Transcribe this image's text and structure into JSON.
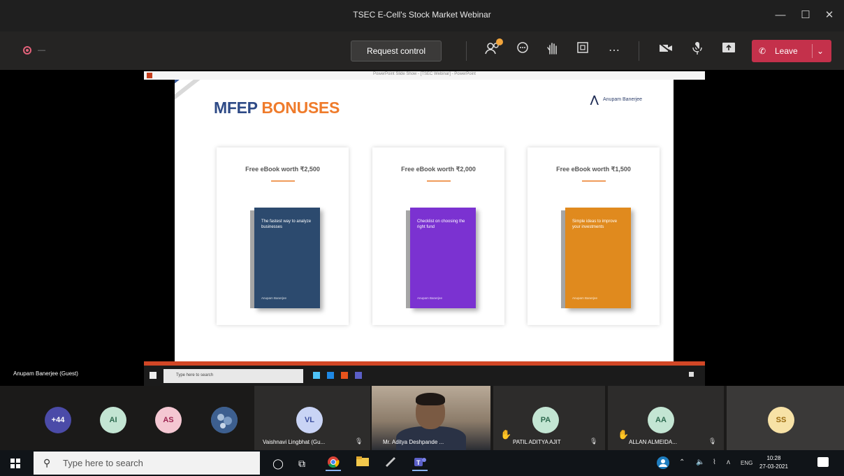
{
  "window": {
    "title": "TSEC E-Cell's Stock Market Webinar"
  },
  "window_controls": {
    "minimize": "—",
    "maximize": "☐",
    "close": "✕"
  },
  "toolbar": {
    "timer": "—",
    "request_control": "Request control",
    "leave_label": "Leave",
    "icons": [
      "participants-icon",
      "chat-icon",
      "raise-hand-icon",
      "share-tray-icon",
      "more-icon",
      "camera-icon",
      "mic-icon",
      "share-icon"
    ]
  },
  "shared_window": {
    "title": "PowerPoint Slide Show - [TSEC Webinar] - PowerPoint"
  },
  "slide": {
    "title_part1": "MFEP",
    "title_part2": "BONUSES",
    "logo_text": "Anupam Banerjee",
    "cards": [
      {
        "caption": "Free eBook worth ₹2,500",
        "book_title": "The fastest way to analyze businesses",
        "book_author": "Anupam Banerjee",
        "color": "#2c4a6e"
      },
      {
        "caption": "Free eBook worth ₹2,000",
        "book_title": "Checklist on choosing the right fund",
        "book_author": "Anupam Banerjee",
        "color": "#7b32d1"
      },
      {
        "caption": "Free eBook worth ₹1,500",
        "book_title": "Simple ideas to improve your investments",
        "book_author": "Anupam Banerjee",
        "color": "#e08a1e"
      }
    ],
    "accent_blue": "#2e4a86",
    "accent_orange": "#ef7b2b"
  },
  "speaker_label": "Anupam Banerjee (Guest)",
  "inner_taskbar": {
    "search_placeholder": "Type here to search"
  },
  "participants": [
    {
      "initials": "+44",
      "color": "#4b4ba8",
      "text": "#fff"
    },
    {
      "initials": "AI",
      "color": "#c3e5d3",
      "text": "#2d6a4f"
    },
    {
      "initials": "AS",
      "color": "#f4c7d2",
      "text": "#9c2450"
    },
    {
      "initials": "",
      "color": "#5a7aa6",
      "text": "#fff"
    },
    {
      "initials": "VL",
      "color": "#c9d4f5",
      "text": "#3c4f9e",
      "name": "Vaishnavi Lingbhat (Gu..."
    },
    {
      "initials": "",
      "name": "Mr. Aditya Deshpande ..."
    },
    {
      "initials": "PA",
      "color": "#c3e5d3",
      "text": "#2d6a4f",
      "name": "PATIL ADITYA AJIT"
    },
    {
      "initials": "AA",
      "color": "#c3e5d3",
      "text": "#2d6a4f",
      "name": "ALLAN ALMEIDA..."
    },
    {
      "initials": "SS",
      "color": "#f7e2a6",
      "text": "#9a6b10"
    }
  ],
  "taskbar": {
    "search_placeholder": "Type here to search",
    "lang": "ENG",
    "time": "10:28",
    "date": "27-03-2021"
  }
}
